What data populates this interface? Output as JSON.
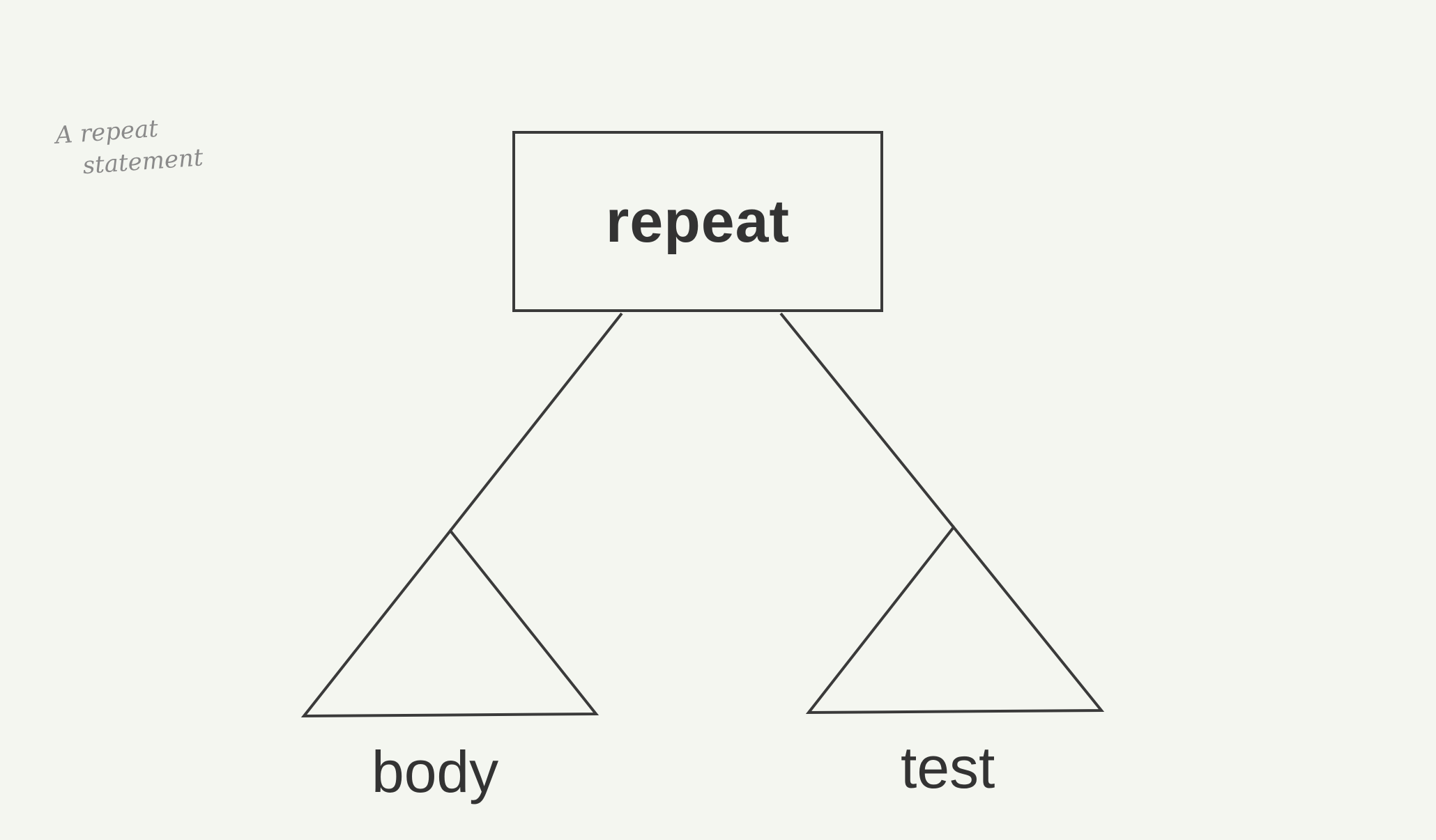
{
  "note": {
    "line1": "A repeat",
    "line2": "statement"
  },
  "root": {
    "label": "repeat"
  },
  "children": {
    "left_label": "body",
    "right_label": "test"
  },
  "colors": {
    "ink": "#333333",
    "paper": "#f4f6f0",
    "pencil": "#8a8a8a"
  }
}
